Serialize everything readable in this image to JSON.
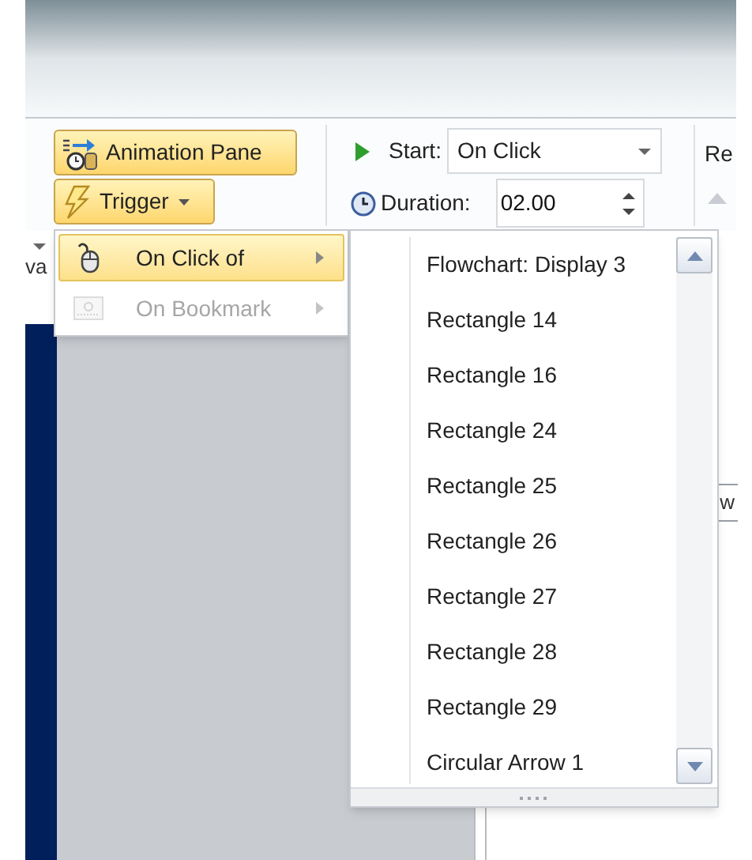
{
  "ribbon": {
    "animation_pane": {
      "label": "Animation Pane"
    },
    "trigger": {
      "label": "Trigger",
      "pressed": true
    },
    "start": {
      "label": "Start:",
      "value": "On Click"
    },
    "duration": {
      "label": "Duration:",
      "value": "02.00"
    },
    "cut_label": "Re"
  },
  "left_fragment": "va",
  "right_fragment": "w",
  "trigger_menu": [
    {
      "label": "On Click of",
      "selected": true,
      "disabled": false,
      "kind": "mouse"
    },
    {
      "label": "On Bookmark",
      "selected": false,
      "disabled": true,
      "kind": "bookmark"
    }
  ],
  "submenu": [
    "Flowchart: Display 3",
    "Rectangle 14",
    "Rectangle 16",
    "Rectangle 24",
    "Rectangle 25",
    "Rectangle 26",
    "Rectangle 27",
    "Rectangle 28",
    "Rectangle 29",
    "Circular Arrow 1"
  ]
}
